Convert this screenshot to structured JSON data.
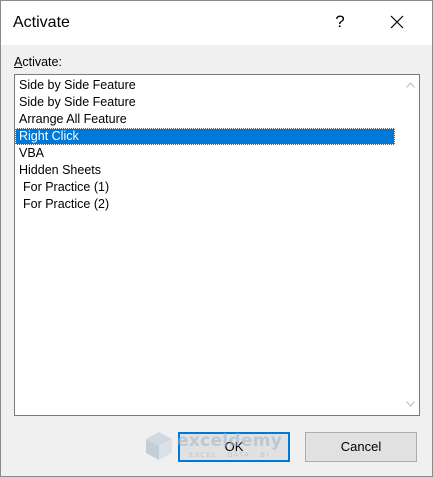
{
  "dialog": {
    "title": "Activate",
    "help_label": "?",
    "close_icon": "close-icon"
  },
  "list": {
    "label_accel": "A",
    "label_rest": "ctivate:",
    "items": [
      "Side by Side Feature",
      "Side by Side Feature",
      "Arrange All Feature",
      "Right Click",
      "VBA",
      "Hidden Sheets",
      "For Practice (1)",
      "For Practice (2)"
    ],
    "selected": "Right Click"
  },
  "buttons": {
    "ok": "OK",
    "cancel": "Cancel"
  },
  "watermark": {
    "name": "exceldemy",
    "tagline": "EXCEL · DATA · BI"
  },
  "colors": {
    "selection": "#0078d7",
    "dialog_bg": "#f0f0f0"
  }
}
